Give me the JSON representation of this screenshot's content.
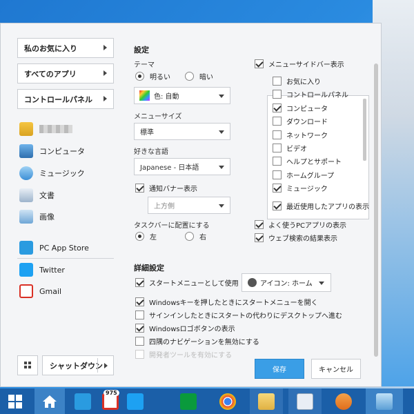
{
  "left": {
    "nav": [
      {
        "label": "私のお気に入り"
      },
      {
        "label": "すべてのアプリ"
      },
      {
        "label": "コントロールパネル"
      }
    ],
    "places": [
      {
        "label": "",
        "icon": "user-folder-icon"
      },
      {
        "label": "コンピュータ",
        "icon": "computer-icon"
      },
      {
        "label": "ミュージック",
        "icon": "music-icon"
      },
      {
        "label": "文書",
        "icon": "documents-icon"
      },
      {
        "label": "画像",
        "icon": "pictures-icon"
      }
    ],
    "apps": [
      {
        "label": "PC App Store",
        "icon": "pc-app-store-icon"
      },
      {
        "label": "Twitter",
        "icon": "twitter-icon"
      },
      {
        "label": "Gmail",
        "icon": "gmail-icon"
      }
    ],
    "shutdown_label": "シャットダウン"
  },
  "settings": {
    "title": "設定",
    "theme_label": "テーマ",
    "theme_light": "明るい",
    "theme_dark": "暗い",
    "theme_selected": "light",
    "color_select": "色: 自動",
    "menu_size_label": "メニューサイズ",
    "menu_size_value": "標準",
    "language_label": "好きな言語",
    "language_value": "Japanese - 日本語",
    "notify_banner": "通知バナー表示",
    "notify_banner_checked": true,
    "notify_position": "上方側",
    "taskbar_place_label": "タスクバーに配置にする",
    "taskbar_left": "左",
    "taskbar_right": "右",
    "taskbar_selected": "left",
    "sidebar_show": "メニューサイドバー表示",
    "sidebar_items": [
      {
        "label": "お気に入り",
        "checked": false
      },
      {
        "label": "コントロールパネル",
        "checked": false
      },
      {
        "label": "コンピュータ",
        "checked": true
      },
      {
        "label": "ダウンロード",
        "checked": false
      },
      {
        "label": "ネットワーク",
        "checked": false
      },
      {
        "label": "ビデオ",
        "checked": false
      },
      {
        "label": "ヘルプとサポート",
        "checked": false
      },
      {
        "label": "ホームグループ",
        "checked": false
      },
      {
        "label": "ミュージック",
        "checked": true
      }
    ],
    "recent_apps": "最近使用したアプリの表示",
    "frequent_apps": "よく使うPCアプリの表示",
    "web_search": "ウェブ検索の結果表示"
  },
  "advanced": {
    "title": "詳細設定",
    "start_menu": "スタートメニューとして使用",
    "icon_select": "アイコン: ホーム",
    "options": [
      {
        "label": "Windowsキーを押したときにスタートメニューを開く",
        "checked": true
      },
      {
        "label": "サインインしたときにスタートの代わりにデスクトップへ進む",
        "checked": false
      },
      {
        "label": "Windowsロゴボタンの表示",
        "checked": true
      },
      {
        "label": "四隅のナビゲーションを無効にする",
        "checked": false
      },
      {
        "label": "開発者ツールを有効にする",
        "checked": false
      }
    ]
  },
  "buttons": {
    "save": "保存",
    "cancel": "キャンセル"
  },
  "taskbar": {
    "gmail_badge": "975"
  },
  "colors": {
    "accent": "#3a9ee6",
    "taskbar": "#1b5fa8",
    "twitter": "#1da1f2",
    "gmail": "#d93025"
  }
}
